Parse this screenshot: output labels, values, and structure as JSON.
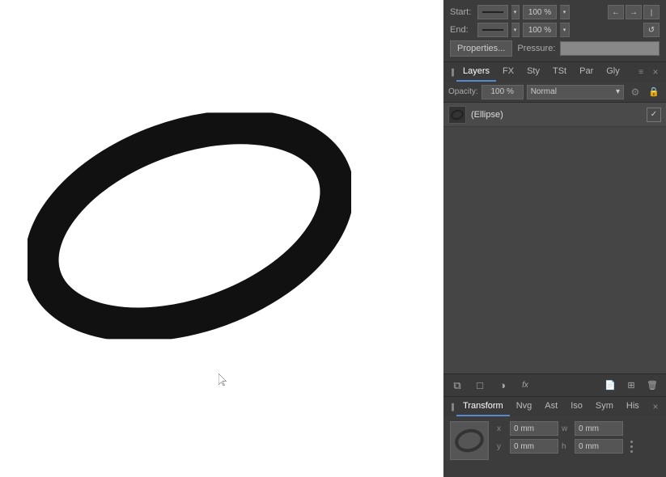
{
  "canvas": {
    "background": "#ffffff"
  },
  "stroke_panel": {
    "start_label": "Start:",
    "end_label": "End:",
    "start_percent": "100 %",
    "end_percent": "100 %",
    "properties_label": "Properties...",
    "pressure_label": "Pressure:"
  },
  "tabs": {
    "layers_label": "Layers",
    "fx_label": "FX",
    "sty_label": "Sty",
    "tst_label": "TSt",
    "par_label": "Par",
    "gly_label": "Gly"
  },
  "layers": {
    "opacity_label": "Opacity:",
    "opacity_value": "100 %",
    "blend_mode": "Normal",
    "layer_name": "(Ellipse)"
  },
  "transform": {
    "transform_label": "Transform",
    "nvg_label": "Nvg",
    "ast_label": "Ast",
    "iso_label": "Iso",
    "sym_label": "Sym",
    "his_label": "His",
    "x_label": "x",
    "y_label": "y",
    "w_label": "w",
    "h_label": "h",
    "x_value": "0 mm",
    "y_value": "0 mm",
    "w_value": "0 mm",
    "h_value": "0 mm"
  },
  "icons": {
    "arrow_right": "→",
    "arrow_left": "←",
    "pin": "📌",
    "refresh": "↺",
    "gear": "⚙",
    "lock": "🔒",
    "layers_icon": "≡",
    "close": "×",
    "collapse": "▐",
    "check": "✓",
    "down_arrow": "▾",
    "stack": "⧉",
    "circle_half": "◑",
    "fx_icon": "fx",
    "new_layer": "□",
    "delete": "🗑",
    "grid": "⊞"
  }
}
